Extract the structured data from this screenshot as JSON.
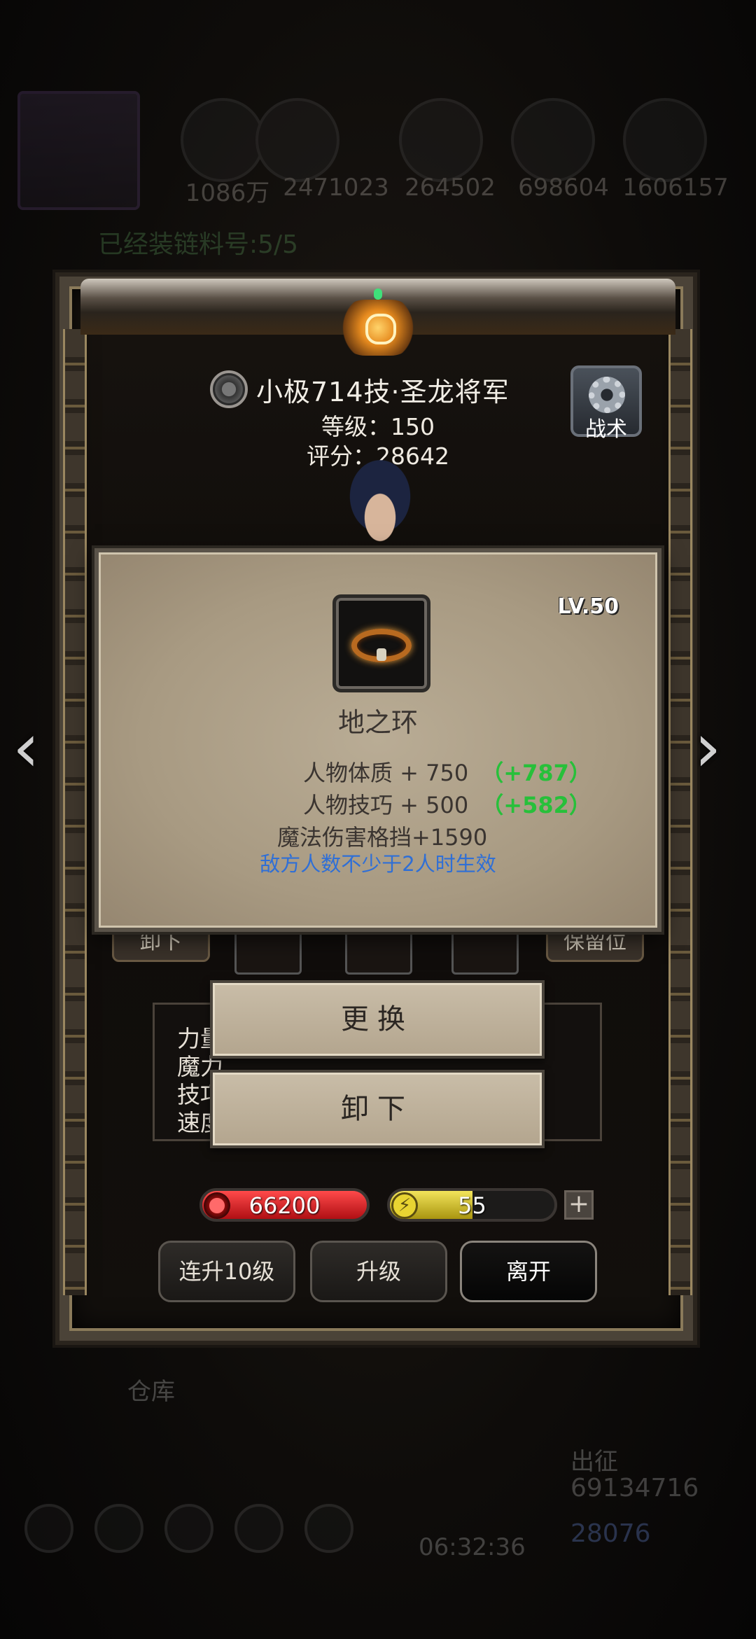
{
  "background": {
    "resources": [
      "1086万",
      "2471023",
      "264502",
      "698604",
      "1606157"
    ],
    "chain_text": "已经装链料号:5/5",
    "warehouse": "仓库",
    "dispatch": "出征",
    "gold": "69134716",
    "gems": "28076",
    "timer": "06:32:36"
  },
  "character": {
    "name": "小极714技·圣龙将军",
    "level": "等级：150",
    "score": "评分：28642",
    "tactics_label": "战术"
  },
  "slots": {
    "left_tag": "卸下",
    "right_tag": "保留位"
  },
  "stats_labels": [
    "力量",
    "魔力",
    "技巧",
    "速度"
  ],
  "item": {
    "level": "LV.50",
    "name": "地之环",
    "stats": [
      {
        "text": "人物体质 + 750",
        "bonus": "（+787）"
      },
      {
        "text": "人物技巧 + 500",
        "bonus": "（+582）"
      }
    ],
    "extra": "魔法伤害格挡+1590",
    "condition": "敌方人数不少于2人时生效"
  },
  "actions": {
    "replace": "更换",
    "unequip": "卸下"
  },
  "bars": {
    "hp": "66200",
    "energy": "55",
    "energy_fill": 0.5,
    "plus": "+"
  },
  "buttons": {
    "level_up_10": "连升10级",
    "level_up": "升级",
    "leave": "离开"
  },
  "nav": {
    "prev": "‹",
    "next": "›"
  },
  "colors": {
    "bonus_green": "#27c03a",
    "condition_blue": "#2f6fd6",
    "hp_red": "#d8141a",
    "energy_yellow": "#e8d432"
  }
}
